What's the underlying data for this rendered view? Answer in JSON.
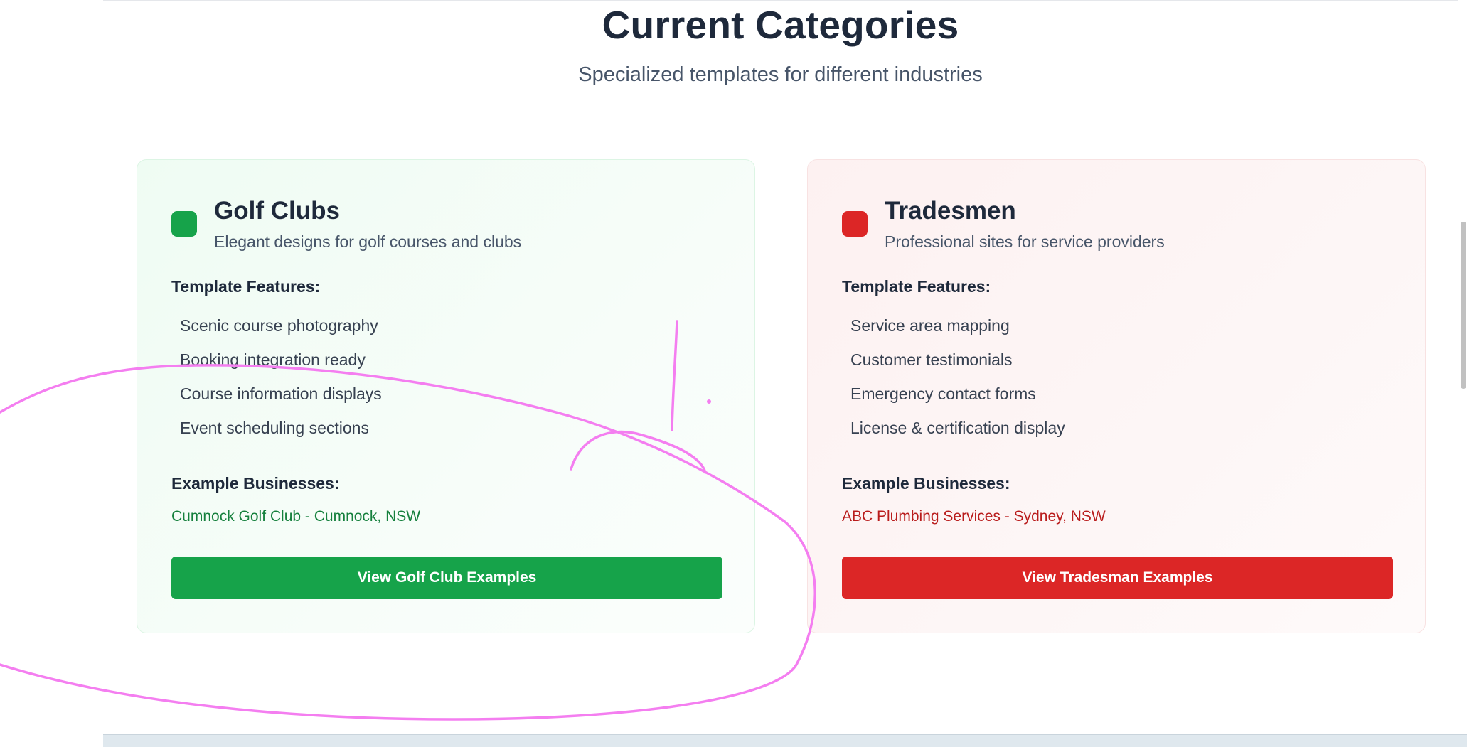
{
  "section": {
    "title": "Current Categories",
    "subtitle": "Specialized templates for different industries"
  },
  "categories": [
    {
      "name": "Golf Clubs",
      "description": "Elegant designs for golf courses and clubs",
      "features_label": "Template Features:",
      "features": [
        "Scenic course photography",
        "Booking integration ready",
        "Course information displays",
        "Event scheduling sections"
      ],
      "examples_label": "Example Businesses:",
      "example": "Cumnock Golf Club - Cumnock, NSW",
      "button_label": "View Golf Club Examples",
      "accent": "#16a34a",
      "example_color": "#15803d"
    },
    {
      "name": "Tradesmen",
      "description": "Professional sites for service providers",
      "features_label": "Template Features:",
      "features": [
        "Service area mapping",
        "Customer testimonials",
        "Emergency contact forms",
        "License & certification display"
      ],
      "examples_label": "Example Businesses:",
      "example": "ABC Plumbing Services - Sydney, NSW",
      "button_label": "View Tradesman Examples",
      "accent": "#dc2626",
      "example_color": "#b91c1c"
    }
  ],
  "annotation_color": "#f47ef0"
}
